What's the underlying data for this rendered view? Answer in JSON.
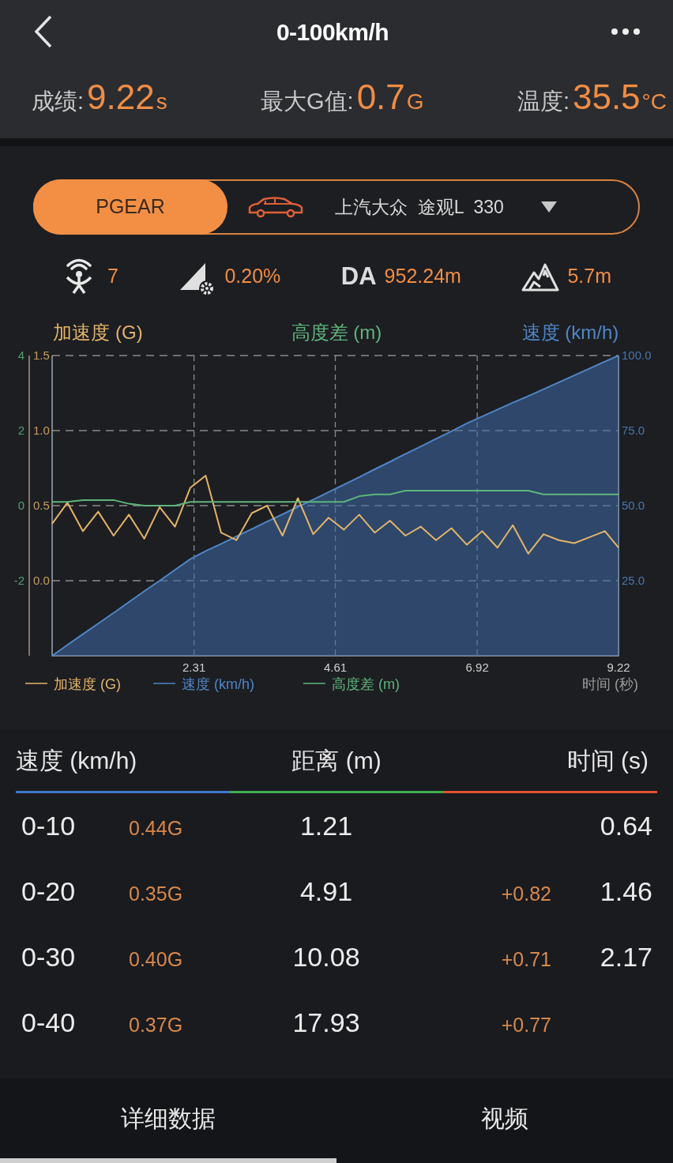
{
  "header": {
    "title": "0-100km/h"
  },
  "results": [
    {
      "label": "成绩:",
      "value": "9.22",
      "unit": "s"
    },
    {
      "label": "最大G值:",
      "value": "0.7",
      "unit": "G"
    },
    {
      "label": "温度:",
      "value": "35.5",
      "unit": "°C"
    }
  ],
  "vehicle_selector": {
    "brand": "PGEAR",
    "vehicle": "上汽大众  途观L  330"
  },
  "metrics": [
    {
      "kind": "satellites",
      "value": "7"
    },
    {
      "kind": "slope",
      "value": "0.20%"
    },
    {
      "kind": "density_altitude",
      "label": "DA",
      "value": "952.24m"
    },
    {
      "kind": "elevation",
      "value": "5.7m"
    }
  ],
  "chart": {
    "chart_data": {
      "type": "line",
      "xlabel": "时间 (秒)",
      "xlim": [
        0,
        9.22
      ],
      "xticks": [
        2.31,
        4.61,
        6.92,
        9.22
      ],
      "grid": true,
      "legend": true,
      "x": [
        0,
        0.25,
        0.5,
        0.75,
        1,
        1.25,
        1.5,
        1.75,
        2,
        2.25,
        2.5,
        2.75,
        3,
        3.25,
        3.5,
        3.75,
        4,
        4.25,
        4.5,
        4.75,
        5,
        5.25,
        5.5,
        5.75,
        6,
        6.25,
        6.5,
        6.75,
        7,
        7.25,
        7.5,
        7.75,
        8,
        8.25,
        8.5,
        8.75,
        9,
        9.22
      ],
      "ylabel": "加速度 (G)",
      "ylim": [
        -0.5,
        1.5
      ],
      "yticks": [
        {
          "value": 0,
          "label": "0.0"
        },
        {
          "value": 0.5,
          "label": "0.5"
        },
        {
          "value": 1,
          "label": "1.0"
        },
        {
          "value": 1.5,
          "label": "1.5"
        }
      ],
      "y2label": "速度 (km/h)",
      "y2lim": [
        0,
        100
      ],
      "y2ticks": [
        {
          "value": 25,
          "label": "25.0"
        },
        {
          "value": 50,
          "label": "50.0"
        },
        {
          "value": 75,
          "label": "75.0"
        },
        {
          "value": 100,
          "label": "100.0"
        }
      ],
      "y3label": "高度差 (m)",
      "y3lim": [
        -4,
        4
      ],
      "y3ticks": [
        -2,
        0,
        2,
        4
      ],
      "series": [
        {
          "name": "加速度 (G)",
          "color": "#e2b469",
          "values": [
            0.38,
            0.52,
            0.33,
            0.46,
            0.3,
            0.44,
            0.28,
            0.49,
            0.36,
            0.62,
            0.7,
            0.32,
            0.27,
            0.45,
            0.5,
            0.3,
            0.55,
            0.31,
            0.42,
            0.34,
            0.44,
            0.32,
            0.4,
            0.3,
            0.36,
            0.27,
            0.35,
            0.24,
            0.33,
            0.22,
            0.37,
            0.18,
            0.31,
            0.27,
            0.25,
            0.29,
            0.33,
            0.22
          ]
        },
        {
          "name": "速度 (km/h)",
          "axis": "y2",
          "color": "#4f86c6",
          "values": [
            0,
            3.6,
            7.2,
            10.7,
            14.3,
            17.9,
            21.5,
            25,
            28.6,
            32.2,
            34.9,
            37.3,
            39.8,
            42.2,
            44.7,
            47.1,
            49.6,
            52,
            54.5,
            57,
            59.5,
            62.1,
            64.6,
            67.2,
            69.7,
            72.3,
            74.8,
            77.4,
            79.7,
            82,
            84.3,
            86.5,
            88.8,
            91.1,
            93.4,
            95.7,
            98,
            100
          ]
        },
        {
          "name": "高度差 (m)",
          "axis": "y3",
          "color": "#5fb57c",
          "values": [
            0.1,
            0.1,
            0.15,
            0.15,
            0.15,
            0.05,
            0,
            0,
            0,
            0.1,
            0.1,
            0.1,
            0.1,
            0.1,
            0.1,
            0.1,
            0.1,
            0.1,
            0.1,
            0.1,
            0.25,
            0.3,
            0.3,
            0.4,
            0.4,
            0.4,
            0.4,
            0.4,
            0.4,
            0.4,
            0.4,
            0.4,
            0.3,
            0.3,
            0.3,
            0.3,
            0.3,
            0.3
          ]
        }
      ]
    }
  },
  "splits": {
    "columns": [
      "速度 (km/h)",
      "距离 (m)",
      "时间 (s)"
    ],
    "rows": [
      {
        "range": "0-10",
        "g": "0.44G",
        "distance": "1.21",
        "time": "0.64"
      },
      {
        "range": "0-20",
        "g": "0.35G",
        "distance": "4.91",
        "delta": "+0.82",
        "time": "1.46"
      },
      {
        "range": "0-30",
        "g": "0.40G",
        "distance": "10.08",
        "delta": "+0.71",
        "time": "2.17"
      },
      {
        "range": "0-40",
        "g": "0.37G",
        "distance": "17.93",
        "delta": "+0.77"
      }
    ]
  },
  "tabs": [
    {
      "label": "详细数据",
      "selected": true
    },
    {
      "label": "视频",
      "selected": false
    }
  ]
}
